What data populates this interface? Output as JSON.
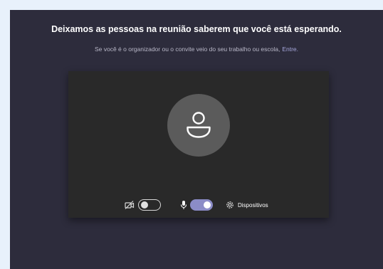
{
  "header": {
    "title": "Deixamos as pessoas na reunião saberem que você está esperando.",
    "subtitle": "Se você é o organizador ou o convite veio do seu trabalho ou escola,",
    "sign_in_link": "Entre."
  },
  "preview": {
    "avatar_icon": "person-icon"
  },
  "controls": {
    "camera_icon": "camera-off-icon",
    "camera_on": false,
    "mic_icon": "microphone-icon",
    "mic_on": true,
    "devices_icon": "gear-icon",
    "devices_label": "Dispositivos"
  },
  "colors": {
    "background": "#2d2c3c",
    "preview": "#292929",
    "accent": "#8b8cc7",
    "link": "#a6a7dc"
  }
}
